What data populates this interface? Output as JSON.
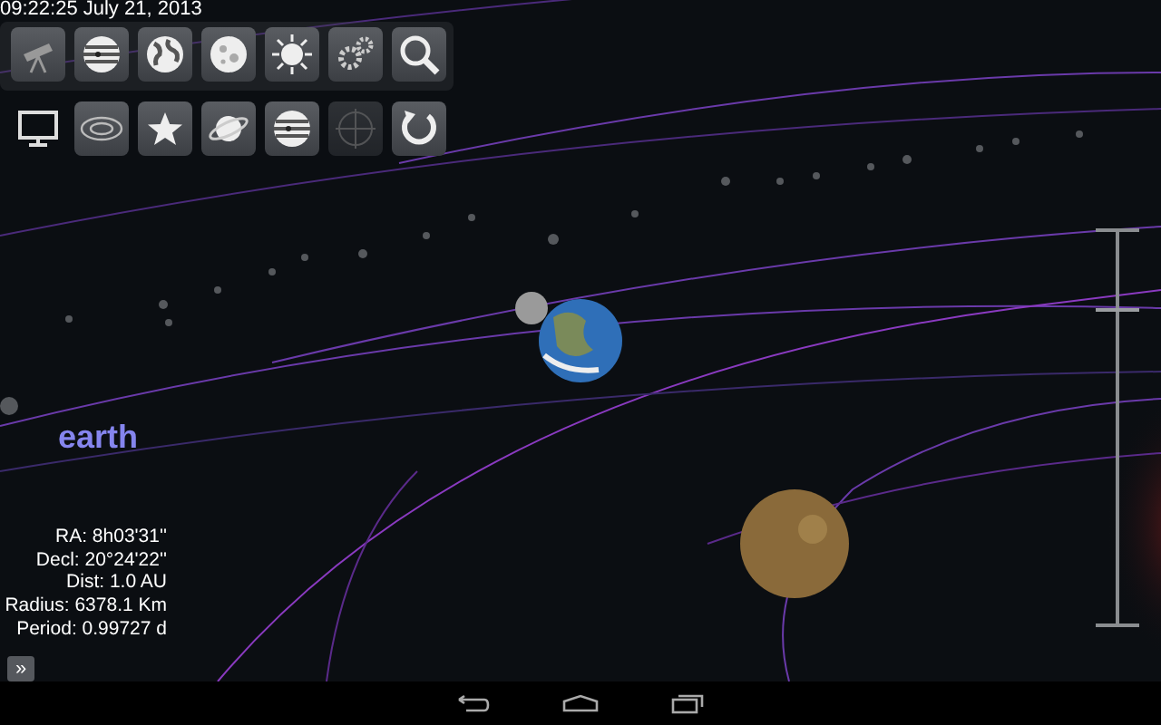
{
  "status_time": "09:22:25 July 21, 2013",
  "toolbar": [
    [
      {
        "kind": "telescope",
        "disabled": false
      },
      {
        "kind": "jupiter",
        "disabled": false
      },
      {
        "kind": "globe",
        "disabled": false
      },
      {
        "kind": "moon",
        "disabled": false
      },
      {
        "kind": "sun",
        "disabled": false
      },
      {
        "kind": "gears",
        "disabled": false
      },
      {
        "kind": "search",
        "disabled": false
      }
    ],
    [
      {
        "kind": "monitor",
        "disabled": false
      },
      {
        "kind": "orbit",
        "disabled": false
      },
      {
        "kind": "star",
        "disabled": false
      },
      {
        "kind": "saturn",
        "disabled": false
      },
      {
        "kind": "jupiter",
        "disabled": false
      },
      {
        "kind": "crosshair",
        "disabled": true
      },
      {
        "kind": "refresh",
        "disabled": false
      }
    ]
  ],
  "selected_body": {
    "name": "earth",
    "details": [
      "RA: 8h03'31''",
      "Decl: 20°24'22''",
      "Dist: 1.0 AU",
      "Radius: 6378.1 Km",
      "Period: 0.99727 d"
    ]
  },
  "expand_button": "»",
  "zoom_slider": {
    "level": 0.8
  }
}
